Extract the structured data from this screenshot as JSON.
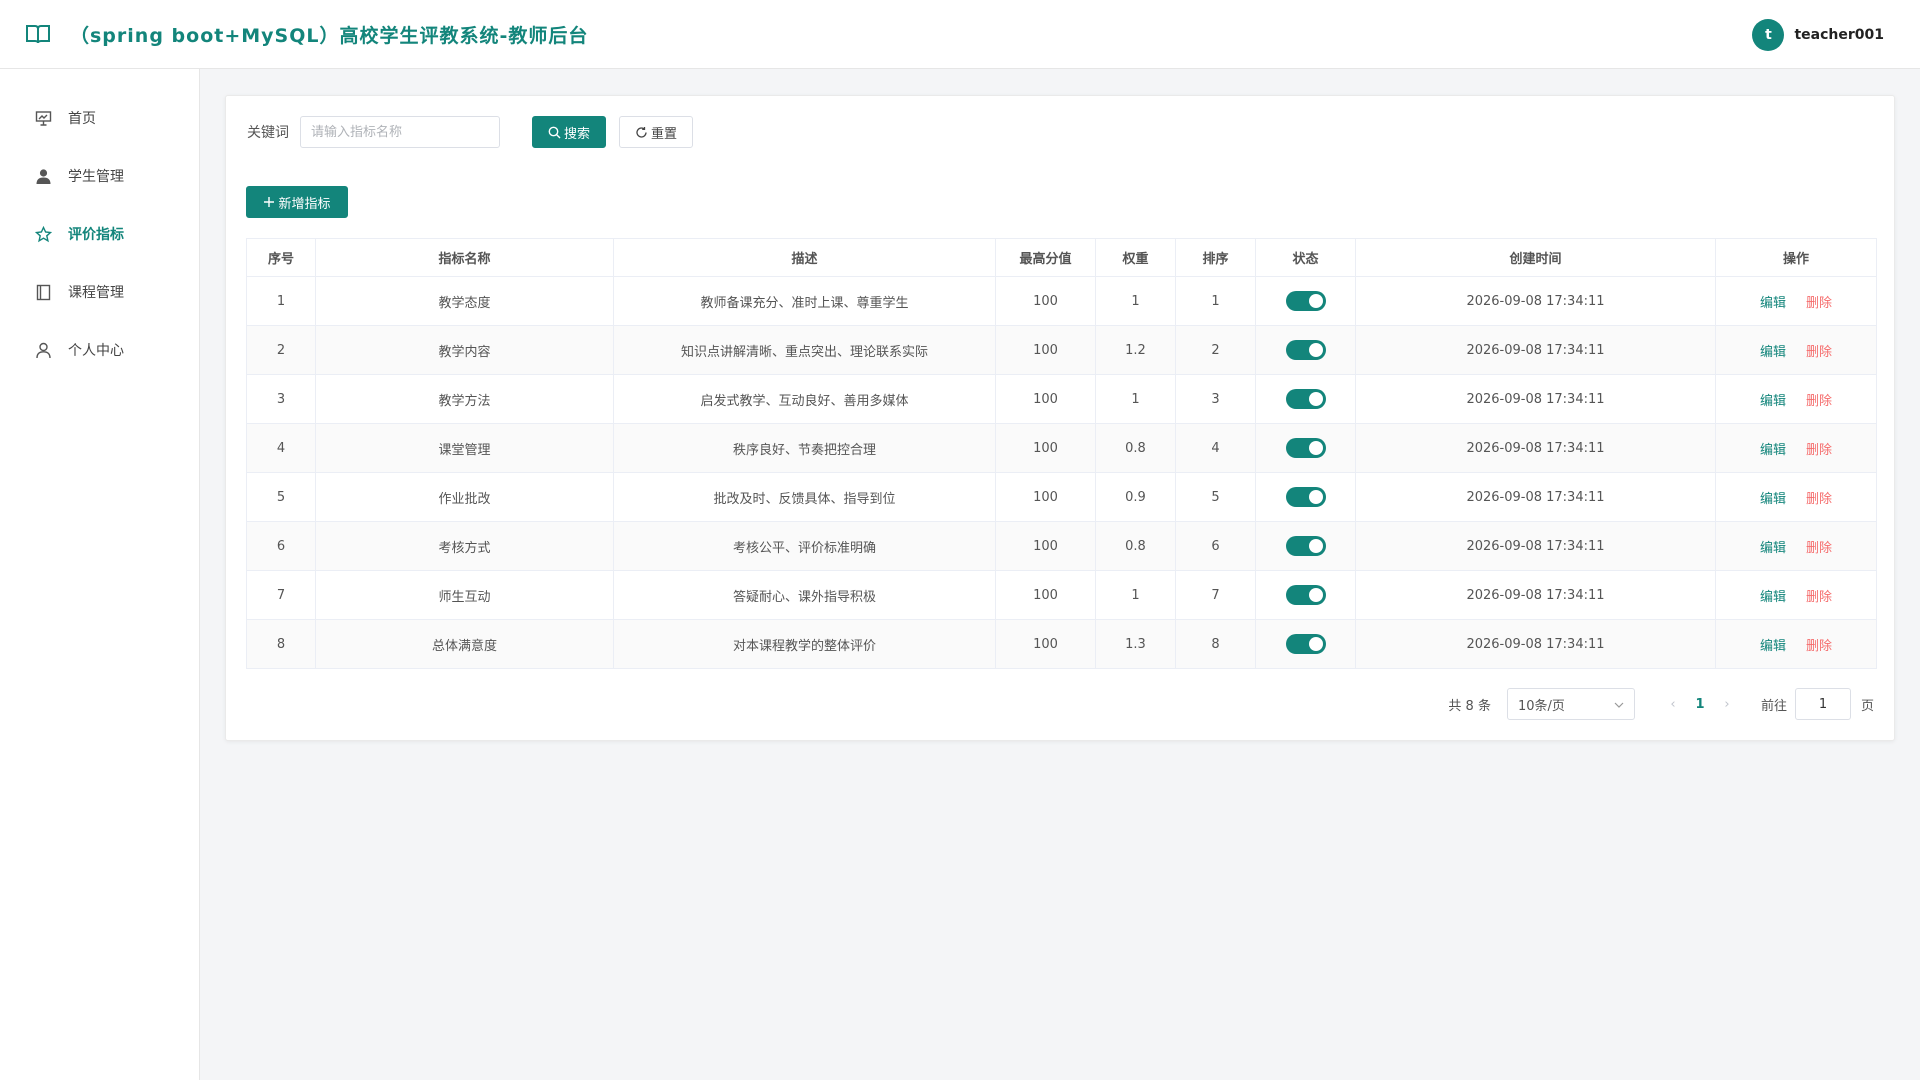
{
  "header": {
    "title": "（spring boot+MySQL）高校学生评教系统-教师后台",
    "avatar_letter": "t",
    "username": "teacher001",
    "brand_color": "#13857b"
  },
  "sidebar": {
    "items": [
      {
        "label": "首页",
        "icon": "presentation-icon",
        "active": false
      },
      {
        "label": "学生管理",
        "icon": "user-icon",
        "active": false
      },
      {
        "label": "评价指标",
        "icon": "star-icon",
        "active": true
      },
      {
        "label": "课程管理",
        "icon": "book-icon",
        "active": false
      },
      {
        "label": "个人中心",
        "icon": "person-outline-icon",
        "active": false
      }
    ]
  },
  "search": {
    "label": "关键词",
    "placeholder": "请输入指标名称",
    "value": "",
    "search_label": "搜索",
    "reset_label": "重置"
  },
  "toolbar": {
    "add_label": "新增指标"
  },
  "table": {
    "headers": [
      "序号",
      "指标名称",
      "描述",
      "最高分值",
      "权重",
      "排序",
      "状态",
      "创建时间",
      "操作"
    ],
    "edit_label": "编辑",
    "delete_label": "删除",
    "rows": [
      {
        "no": "1",
        "name": "教学态度",
        "desc": "教师备课充分、准时上课、尊重学生",
        "max": "100",
        "weight": "1",
        "order": "1",
        "enabled": true,
        "created": "2026-09-08 17:34:11"
      },
      {
        "no": "2",
        "name": "教学内容",
        "desc": "知识点讲解清晰、重点突出、理论联系实际",
        "max": "100",
        "weight": "1.2",
        "order": "2",
        "enabled": true,
        "created": "2026-09-08 17:34:11"
      },
      {
        "no": "3",
        "name": "教学方法",
        "desc": "启发式教学、互动良好、善用多媒体",
        "max": "100",
        "weight": "1",
        "order": "3",
        "enabled": true,
        "created": "2026-09-08 17:34:11"
      },
      {
        "no": "4",
        "name": "课堂管理",
        "desc": "秩序良好、节奏把控合理",
        "max": "100",
        "weight": "0.8",
        "order": "4",
        "enabled": true,
        "created": "2026-09-08 17:34:11"
      },
      {
        "no": "5",
        "name": "作业批改",
        "desc": "批改及时、反馈具体、指导到位",
        "max": "100",
        "weight": "0.9",
        "order": "5",
        "enabled": true,
        "created": "2026-09-08 17:34:11"
      },
      {
        "no": "6",
        "name": "考核方式",
        "desc": "考核公平、评价标准明确",
        "max": "100",
        "weight": "0.8",
        "order": "6",
        "enabled": true,
        "created": "2026-09-08 17:34:11"
      },
      {
        "no": "7",
        "name": "师生互动",
        "desc": "答疑耐心、课外指导积极",
        "max": "100",
        "weight": "1",
        "order": "7",
        "enabled": true,
        "created": "2026-09-08 17:34:11"
      },
      {
        "no": "8",
        "name": "总体满意度",
        "desc": "对本课程教学的整体评价",
        "max": "100",
        "weight": "1.3",
        "order": "8",
        "enabled": true,
        "created": "2026-09-08 17:34:11"
      }
    ]
  },
  "pagination": {
    "total_text": "共 8 条",
    "page_size": "10条/页",
    "current_page": "1",
    "goto_label": "前往",
    "goto_value": "1",
    "goto_suffix": "页"
  }
}
